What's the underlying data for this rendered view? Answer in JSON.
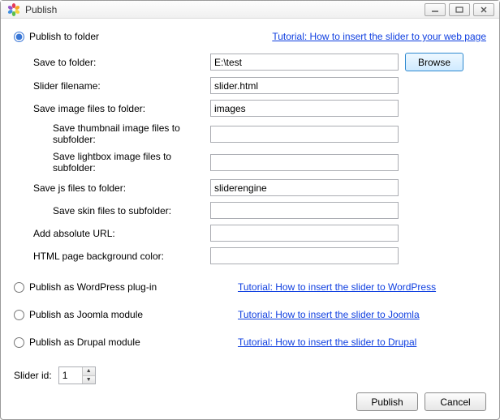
{
  "window": {
    "title": "Publish"
  },
  "tutorial": {
    "folder": "Tutorial: How to insert the slider to your web page",
    "wordpress": "Tutorial: How to insert the slider to WordPress",
    "joomla": "Tutorial: How to insert the slider to Joomla",
    "drupal": "Tutorial: How to insert the slider to Drupal"
  },
  "options": {
    "folder": "Publish to folder",
    "wordpress": "Publish as WordPress plug-in",
    "joomla": "Publish as Joomla module",
    "drupal": "Publish as Drupal module"
  },
  "fields": {
    "save_to_folder": {
      "label": "Save to folder:",
      "value": "E:\\test"
    },
    "slider_filename": {
      "label": "Slider filename:",
      "value": "slider.html"
    },
    "image_folder": {
      "label": "Save image files to folder:",
      "value": "images"
    },
    "thumb_subfolder": {
      "label": "Save thumbnail image files to subfolder:",
      "value": ""
    },
    "lightbox_subfolder": {
      "label": "Save lightbox image files to subfolder:",
      "value": ""
    },
    "js_folder": {
      "label": "Save js files to folder:",
      "value": "sliderengine"
    },
    "skin_subfolder": {
      "label": "Save skin files to subfolder:",
      "value": ""
    },
    "absolute_url": {
      "label": "Add absolute URL:",
      "value": ""
    },
    "bg_color": {
      "label": "HTML page background color:",
      "value": ""
    }
  },
  "slider_id": {
    "label": "Slider id:",
    "value": "1"
  },
  "buttons": {
    "browse": "Browse",
    "publish": "Publish",
    "cancel": "Cancel"
  }
}
